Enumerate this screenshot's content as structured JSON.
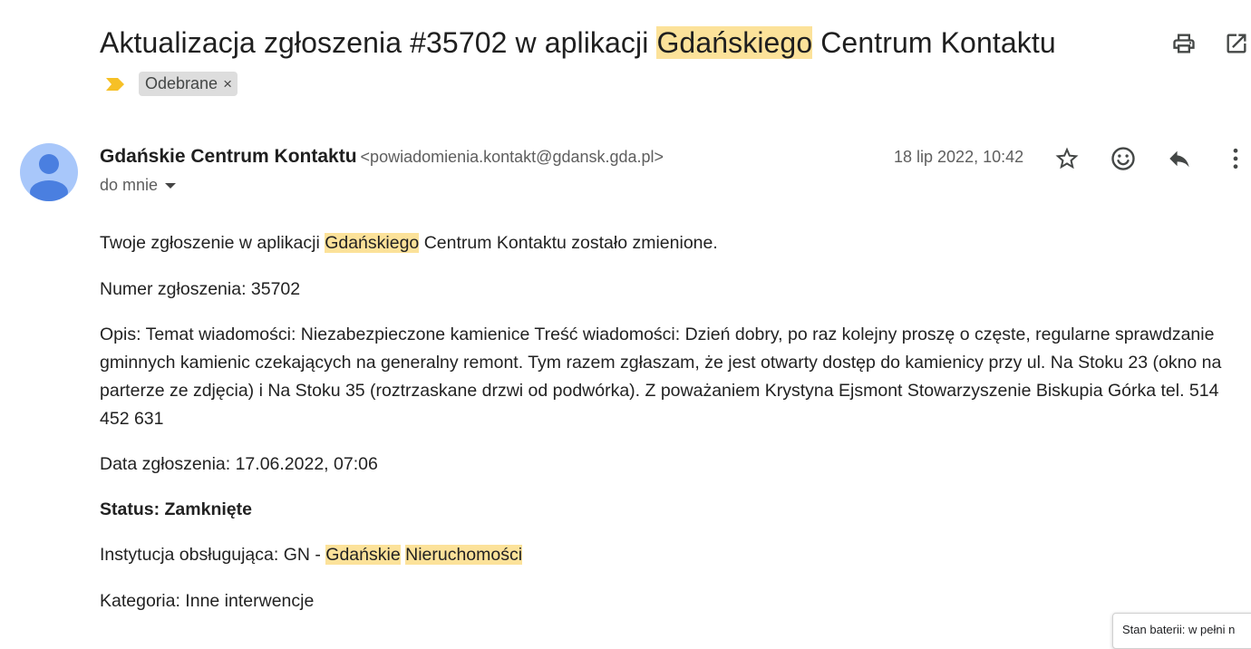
{
  "subject": {
    "before": "Aktualizacja zgłoszenia #35702 w aplikacji ",
    "highlight": "Gdańskiego",
    "after": " Centrum Kontaktu"
  },
  "labels": [
    {
      "name": "Odebrane",
      "remove": "×"
    }
  ],
  "sender": {
    "name": "Gdańskie Centrum Kontaktu",
    "email": "<powiadomienia.kontakt@gdansk.gda.pl>",
    "recipient": "do mnie",
    "date": "18 lip 2022, 10:42"
  },
  "body": {
    "intro": {
      "before": "Twoje zgłoszenie w aplikacji ",
      "highlight": "Gdańskiego",
      "after": " Centrum Kontaktu zostało zmienione."
    },
    "number": "Numer zgłoszenia: 35702",
    "description": "Opis: Temat wiadomości: Niezabezpieczone kamienice Treść wiadomości: Dzień dobry, po raz kolejny proszę o częste, regularne sprawdzanie gminnych kamienic czekających na generalny remont. Tym razem zgłaszam, że jest otwarty dostęp do kamienicy przy ul. Na Stoku 23 (okno na parterze ze zdjęcia) i Na Stoku 35 (roztrzaskane drzwi od podwórka). Z poważaniem Krystyna Ejsmont Stowarzyszenie Biskupia Górka tel. 514 452 631",
    "date": "Data zgłoszenia: 17.06.2022, 07:06",
    "status": "Status: Zamknięte",
    "institution": {
      "before": "Instytucja obsługująca: GN - ",
      "highlight1": "Gdańskie",
      "between": " ",
      "highlight2": "Nieruchomości"
    },
    "category": "Kategoria: Inne interwencje"
  },
  "toast": "Stan baterii: w pełni n",
  "icons": {
    "print": "print-icon",
    "popout": "open-in-new-window-icon",
    "important": "important-marker-icon",
    "avatar": "person-icon",
    "star": "star-icon",
    "emoji": "emoji-reaction-icon",
    "reply": "reply-icon",
    "more": "more-vertical-icon"
  },
  "colors": {
    "highlight": "#fce29a",
    "important_marker": "#f6c026",
    "avatar_bg": "#a8c7fa",
    "avatar_fg": "#4a7fe0",
    "label_chip_bg": "#dddddd"
  }
}
